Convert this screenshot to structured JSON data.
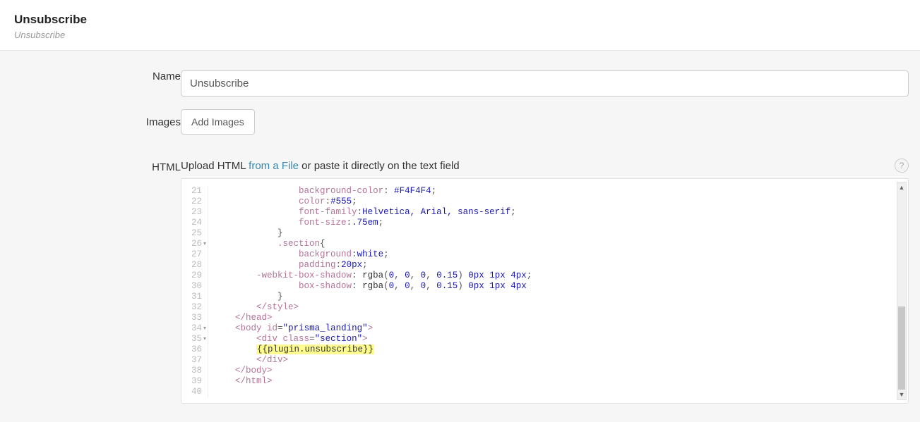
{
  "header": {
    "title": "Unsubscribe",
    "subtitle": "Unsubscribe"
  },
  "form": {
    "name_label": "Name",
    "name_value": "Unsubscribe",
    "images_label": "Images",
    "add_images_label": "Add Images",
    "html_label": "HTML",
    "upload_prefix": "Upload HTML ",
    "upload_link": "from a File",
    "upload_suffix": " or paste it directly on the text field",
    "help_icon": "?"
  },
  "code": {
    "first_line_number": 21,
    "fold_lines": [
      26,
      34,
      35
    ],
    "lines": [
      {
        "indent": 16,
        "tokens": [
          {
            "t": "prop",
            "v": "background-color"
          },
          {
            "t": "punc",
            "v": ": "
          },
          {
            "t": "val",
            "v": "#F4F4F4"
          },
          {
            "t": "punc",
            "v": ";"
          }
        ]
      },
      {
        "indent": 16,
        "tokens": [
          {
            "t": "prop",
            "v": "color"
          },
          {
            "t": "punc",
            "v": ":"
          },
          {
            "t": "val",
            "v": "#555"
          },
          {
            "t": "punc",
            "v": ";"
          }
        ]
      },
      {
        "indent": 16,
        "tokens": [
          {
            "t": "prop",
            "v": "font-family"
          },
          {
            "t": "punc",
            "v": ":"
          },
          {
            "t": "val",
            "v": "Helvetica, Arial, sans-serif"
          },
          {
            "t": "punc",
            "v": ";"
          }
        ]
      },
      {
        "indent": 16,
        "tokens": [
          {
            "t": "prop",
            "v": "font-size"
          },
          {
            "t": "punc",
            "v": ":"
          },
          {
            "t": "val",
            "v": ".75em"
          },
          {
            "t": "punc",
            "v": ";"
          }
        ]
      },
      {
        "indent": 12,
        "tokens": [
          {
            "t": "punc",
            "v": "}"
          }
        ]
      },
      {
        "indent": 12,
        "tokens": [
          {
            "t": "prop",
            "v": ".section"
          },
          {
            "t": "punc",
            "v": "{"
          }
        ]
      },
      {
        "indent": 16,
        "tokens": [
          {
            "t": "prop",
            "v": "background"
          },
          {
            "t": "punc",
            "v": ":"
          },
          {
            "t": "val",
            "v": "white"
          },
          {
            "t": "punc",
            "v": ";"
          }
        ]
      },
      {
        "indent": 16,
        "tokens": [
          {
            "t": "prop",
            "v": "padding"
          },
          {
            "t": "punc",
            "v": ":"
          },
          {
            "t": "val",
            "v": "20px"
          },
          {
            "t": "punc",
            "v": ";"
          }
        ]
      },
      {
        "indent": 8,
        "tokens": [
          {
            "t": "prop",
            "v": "-webkit-box-shadow"
          },
          {
            "t": "punc",
            "v": ": "
          },
          {
            "t": "fn",
            "v": "rgba"
          },
          {
            "t": "punc",
            "v": "("
          },
          {
            "t": "num",
            "v": "0"
          },
          {
            "t": "punc",
            "v": ", "
          },
          {
            "t": "num",
            "v": "0"
          },
          {
            "t": "punc",
            "v": ", "
          },
          {
            "t": "num",
            "v": "0"
          },
          {
            "t": "punc",
            "v": ", "
          },
          {
            "t": "num",
            "v": "0.15"
          },
          {
            "t": "punc",
            "v": ") "
          },
          {
            "t": "num",
            "v": "0px"
          },
          {
            "t": "punc",
            "v": " "
          },
          {
            "t": "num",
            "v": "1px"
          },
          {
            "t": "punc",
            "v": " "
          },
          {
            "t": "num",
            "v": "4px"
          },
          {
            "t": "punc",
            "v": ";"
          }
        ]
      },
      {
        "indent": 16,
        "tokens": [
          {
            "t": "prop",
            "v": "box-shadow"
          },
          {
            "t": "punc",
            "v": ": "
          },
          {
            "t": "fn",
            "v": "rgba"
          },
          {
            "t": "punc",
            "v": "("
          },
          {
            "t": "num",
            "v": "0"
          },
          {
            "t": "punc",
            "v": ", "
          },
          {
            "t": "num",
            "v": "0"
          },
          {
            "t": "punc",
            "v": ", "
          },
          {
            "t": "num",
            "v": "0"
          },
          {
            "t": "punc",
            "v": ", "
          },
          {
            "t": "num",
            "v": "0.15"
          },
          {
            "t": "punc",
            "v": ") "
          },
          {
            "t": "num",
            "v": "0px"
          },
          {
            "t": "punc",
            "v": " "
          },
          {
            "t": "num",
            "v": "1px"
          },
          {
            "t": "punc",
            "v": " "
          },
          {
            "t": "num",
            "v": "4px"
          }
        ]
      },
      {
        "indent": 12,
        "tokens": [
          {
            "t": "punc",
            "v": "}"
          }
        ]
      },
      {
        "indent": 8,
        "tokens": [
          {
            "t": "tag",
            "v": "</style>"
          }
        ]
      },
      {
        "indent": 4,
        "tokens": [
          {
            "t": "tag",
            "v": "</head>"
          }
        ]
      },
      {
        "indent": 4,
        "tokens": [
          {
            "t": "tag",
            "v": "<body "
          },
          {
            "t": "attr",
            "v": "id"
          },
          {
            "t": "punc",
            "v": "="
          },
          {
            "t": "str",
            "v": "\"prisma_landing\""
          },
          {
            "t": "tag",
            "v": ">"
          }
        ]
      },
      {
        "indent": 8,
        "tokens": [
          {
            "t": "tag",
            "v": "<div "
          },
          {
            "t": "attr",
            "v": "class"
          },
          {
            "t": "punc",
            "v": "="
          },
          {
            "t": "str",
            "v": "\"section\""
          },
          {
            "t": "tag",
            "v": ">"
          }
        ]
      },
      {
        "indent": 8,
        "tokens": [
          {
            "t": "hl",
            "v": "{{plugin.unsubscribe}}"
          }
        ]
      },
      {
        "indent": 8,
        "tokens": [
          {
            "t": "tag",
            "v": "</div>"
          }
        ]
      },
      {
        "indent": 4,
        "tokens": [
          {
            "t": "tag",
            "v": "</body>"
          }
        ]
      },
      {
        "indent": 4,
        "tokens": [
          {
            "t": "tag",
            "v": "</html>"
          }
        ]
      },
      {
        "indent": 0,
        "tokens": []
      }
    ]
  }
}
